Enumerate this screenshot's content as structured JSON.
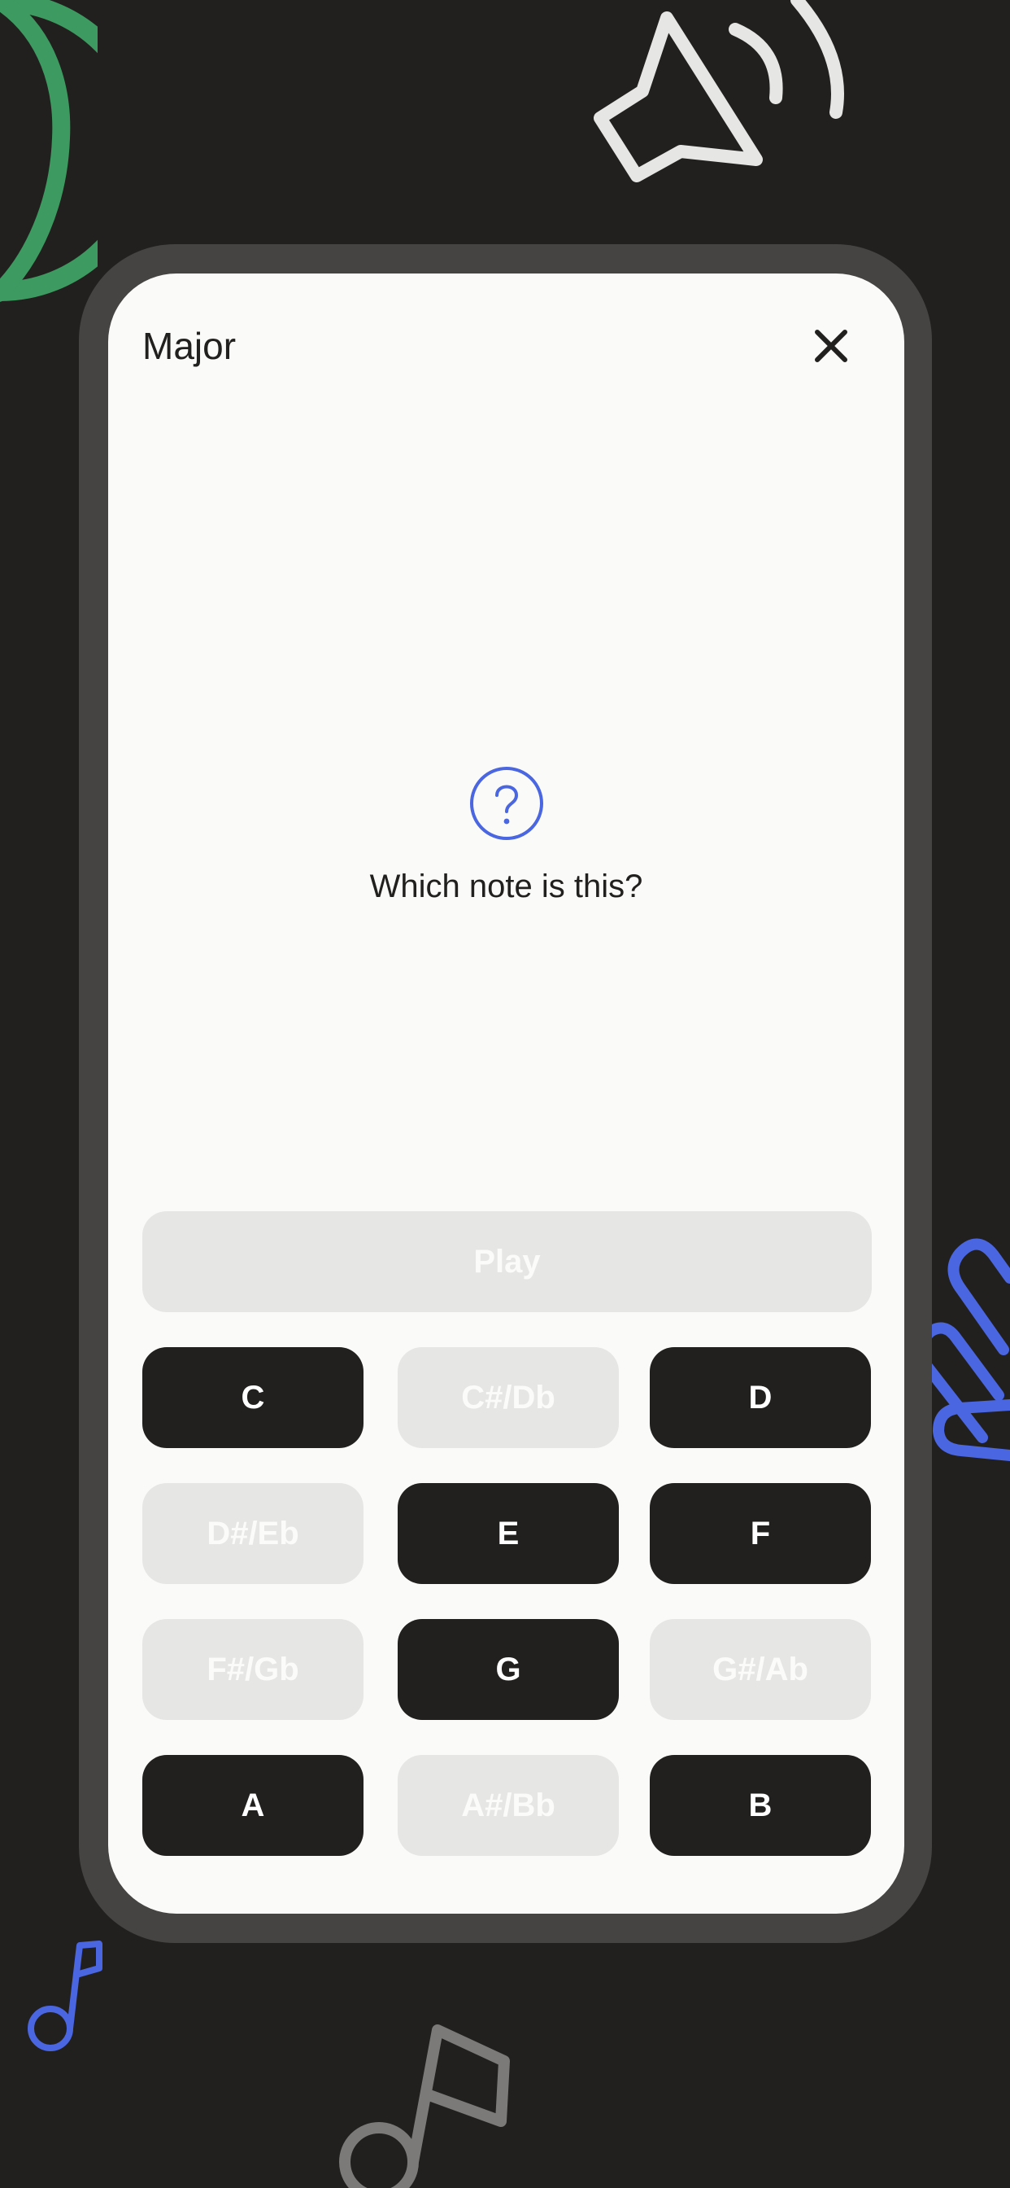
{
  "screen": {
    "title": "Major",
    "question_text": "Which note is this?",
    "play_label": "Play"
  },
  "notes": [
    {
      "label": "C",
      "kind": "natural"
    },
    {
      "label": "C#/Db",
      "kind": "accidental"
    },
    {
      "label": "D",
      "kind": "natural"
    },
    {
      "label": "D#/Eb",
      "kind": "accidental"
    },
    {
      "label": "E",
      "kind": "natural"
    },
    {
      "label": "F",
      "kind": "natural"
    },
    {
      "label": "F#/Gb",
      "kind": "accidental"
    },
    {
      "label": "G",
      "kind": "natural"
    },
    {
      "label": "G#/Ab",
      "kind": "accidental"
    },
    {
      "label": "A",
      "kind": "natural"
    },
    {
      "label": "A#/Bb",
      "kind": "accidental"
    },
    {
      "label": "B",
      "kind": "natural"
    }
  ],
  "icons": {
    "close": "close-icon",
    "question": "question-circle-icon",
    "speaker": "speaker-icon",
    "circle": "circle-icon",
    "hand": "hand-icon",
    "music_note_small": "music-note-icon",
    "music_note_large": "music-note-icon"
  },
  "colors": {
    "background": "#22201e",
    "bezel": "#454442",
    "screen": "#fafaf8",
    "accent_blue": "#4a66e0",
    "accent_green": "#3d9a60",
    "natural_key": "#22201e",
    "disabled_key": "#e6e6e4"
  }
}
